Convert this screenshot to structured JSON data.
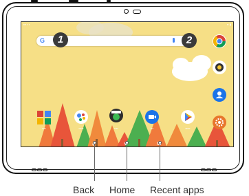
{
  "callouts": {
    "one": "1",
    "two": "2"
  },
  "labels": {
    "back": "Back",
    "home": "Home",
    "recent": "Recent apps"
  },
  "icons": {
    "search": "google-g-icon",
    "mic": "mic-icon",
    "chrome": "chrome-icon",
    "camera": "camera-icon",
    "contacts": "contacts-icon",
    "settings": "settings-icon",
    "play": "play-store-icon",
    "assistant": "assistant-icon",
    "video": "video-call-icon",
    "photos": "photos-icon"
  },
  "colors": {
    "wallpaper": "#f6df86",
    "tree_orange": "#f07a3c",
    "tree_red": "#e8553a",
    "tree_green": "#4caf50",
    "cloud": "#ffffff"
  }
}
